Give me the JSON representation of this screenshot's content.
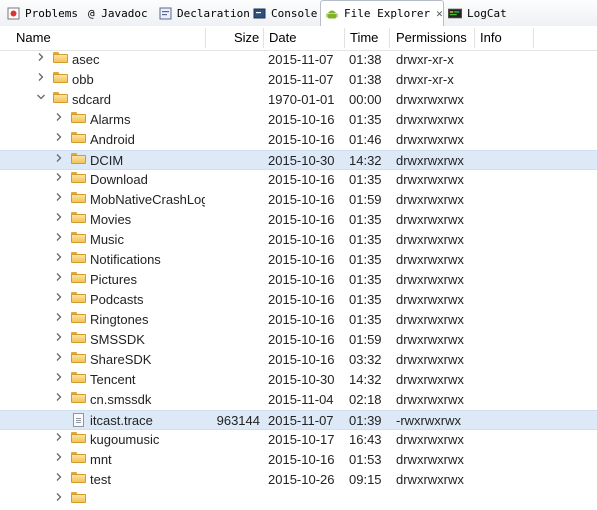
{
  "tabs": [
    {
      "label": "Problems",
      "icon": "problems-icon"
    },
    {
      "label": "@ Javadoc",
      "icon": ""
    },
    {
      "label": "Declaration",
      "icon": "declaration-icon"
    },
    {
      "label": "Console",
      "icon": "console-icon"
    },
    {
      "label": "File Explorer",
      "icon": "android-icon",
      "active": true
    },
    {
      "label": "LogCat",
      "icon": "logcat-icon"
    }
  ],
  "columns": {
    "name": "Name",
    "size": "Size",
    "date": "Date",
    "time": "Time",
    "permissions": "Permissions",
    "info": "Info"
  },
  "rows": [
    {
      "level": 1,
      "expander": "collapsed",
      "type": "folder",
      "name": "asec",
      "size": "",
      "date": "2015-11-07",
      "time": "01:38",
      "permissions": "drwxr-xr-x"
    },
    {
      "level": 1,
      "expander": "collapsed",
      "type": "folder",
      "name": "obb",
      "size": "",
      "date": "2015-11-07",
      "time": "01:38",
      "permissions": "drwxr-xr-x"
    },
    {
      "level": 1,
      "expander": "expanded",
      "type": "folder",
      "name": "sdcard",
      "size": "",
      "date": "1970-01-01",
      "time": "00:00",
      "permissions": "drwxrwxrwx"
    },
    {
      "level": 2,
      "expander": "collapsed",
      "type": "folder",
      "name": "Alarms",
      "size": "",
      "date": "2015-10-16",
      "time": "01:35",
      "permissions": "drwxrwxrwx"
    },
    {
      "level": 2,
      "expander": "collapsed",
      "type": "folder",
      "name": "Android",
      "size": "",
      "date": "2015-10-16",
      "time": "01:46",
      "permissions": "drwxrwxrwx"
    },
    {
      "level": 2,
      "expander": "collapsed",
      "type": "folder",
      "name": "DCIM",
      "size": "",
      "date": "2015-10-30",
      "time": "14:32",
      "permissions": "drwxrwxrwx",
      "selected": true
    },
    {
      "level": 2,
      "expander": "collapsed",
      "type": "folder",
      "name": "Download",
      "size": "",
      "date": "2015-10-16",
      "time": "01:35",
      "permissions": "drwxrwxrwx"
    },
    {
      "level": 2,
      "expander": "collapsed",
      "type": "folder",
      "name": "MobNativeCrashLog",
      "size": "",
      "date": "2015-10-16",
      "time": "01:59",
      "permissions": "drwxrwxrwx"
    },
    {
      "level": 2,
      "expander": "collapsed",
      "type": "folder",
      "name": "Movies",
      "size": "",
      "date": "2015-10-16",
      "time": "01:35",
      "permissions": "drwxrwxrwx"
    },
    {
      "level": 2,
      "expander": "collapsed",
      "type": "folder",
      "name": "Music",
      "size": "",
      "date": "2015-10-16",
      "time": "01:35",
      "permissions": "drwxrwxrwx"
    },
    {
      "level": 2,
      "expander": "collapsed",
      "type": "folder",
      "name": "Notifications",
      "size": "",
      "date": "2015-10-16",
      "time": "01:35",
      "permissions": "drwxrwxrwx"
    },
    {
      "level": 2,
      "expander": "collapsed",
      "type": "folder",
      "name": "Pictures",
      "size": "",
      "date": "2015-10-16",
      "time": "01:35",
      "permissions": "drwxrwxrwx"
    },
    {
      "level": 2,
      "expander": "collapsed",
      "type": "folder",
      "name": "Podcasts",
      "size": "",
      "date": "2015-10-16",
      "time": "01:35",
      "permissions": "drwxrwxrwx"
    },
    {
      "level": 2,
      "expander": "collapsed",
      "type": "folder",
      "name": "Ringtones",
      "size": "",
      "date": "2015-10-16",
      "time": "01:35",
      "permissions": "drwxrwxrwx"
    },
    {
      "level": 2,
      "expander": "collapsed",
      "type": "folder",
      "name": "SMSSDK",
      "size": "",
      "date": "2015-10-16",
      "time": "01:59",
      "permissions": "drwxrwxrwx"
    },
    {
      "level": 2,
      "expander": "collapsed",
      "type": "folder",
      "name": "ShareSDK",
      "size": "",
      "date": "2015-10-16",
      "time": "03:32",
      "permissions": "drwxrwxrwx"
    },
    {
      "level": 2,
      "expander": "collapsed",
      "type": "folder",
      "name": "Tencent",
      "size": "",
      "date": "2015-10-30",
      "time": "14:32",
      "permissions": "drwxrwxrwx"
    },
    {
      "level": 2,
      "expander": "collapsed",
      "type": "folder",
      "name": "cn.smssdk",
      "size": "",
      "date": "2015-11-04",
      "time": "02:18",
      "permissions": "drwxrwxrwx"
    },
    {
      "level": 2,
      "expander": "none",
      "type": "file",
      "name": "itcast.trace",
      "size": "963144",
      "date": "2015-11-07",
      "time": "01:39",
      "permissions": "-rwxrwxrwx",
      "selected": true
    },
    {
      "level": 2,
      "expander": "collapsed",
      "type": "folder",
      "name": "kugoumusic",
      "size": "",
      "date": "2015-10-17",
      "time": "16:43",
      "permissions": "drwxrwxrwx"
    },
    {
      "level": 2,
      "expander": "collapsed",
      "type": "folder",
      "name": "mnt",
      "size": "",
      "date": "2015-10-16",
      "time": "01:53",
      "permissions": "drwxrwxrwx"
    },
    {
      "level": 2,
      "expander": "collapsed",
      "type": "folder",
      "name": "test",
      "size": "",
      "date": "2015-10-26",
      "time": "09:15",
      "permissions": "drwxrwxrwx"
    },
    {
      "level": 2,
      "expander": "collapsed",
      "type": "folder",
      "name": "",
      "size": "",
      "date": "",
      "time": "",
      "permissions": ""
    }
  ]
}
